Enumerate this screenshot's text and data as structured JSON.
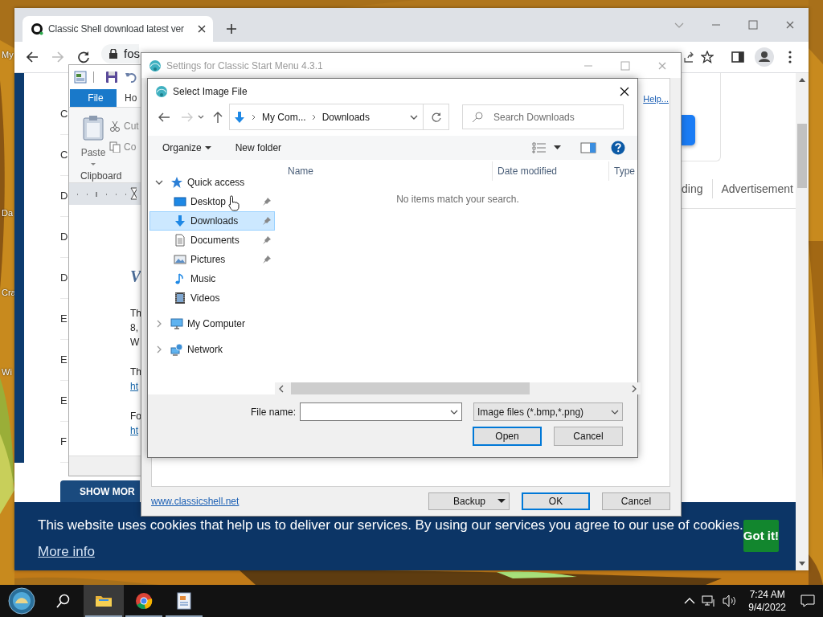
{
  "desktop": {
    "icon_labels": [
      "My",
      "Da",
      "Cra",
      "Wi"
    ]
  },
  "browser": {
    "tab_title": "Classic Shell download latest ver",
    "address": "fos",
    "list_items": [
      "C",
      "C",
      "D",
      "D",
      "D",
      "E",
      "E",
      "E",
      "F"
    ],
    "show_more": "SHOW MOR",
    "ad_tabs": [
      "ding",
      "Advertisement"
    ],
    "cookie_banner": {
      "text": "This website uses cookies that help us to deliver our services. By using our services you agree to our use of cookies.",
      "more_info": "More info",
      "button": "Got it!"
    }
  },
  "wordpad": {
    "tabs": [
      {
        "label": "File",
        "selected": true
      },
      {
        "label": "Ho",
        "selected": false
      }
    ],
    "paste": "Paste",
    "cut": "Cut",
    "copy": "Co",
    "group": "Clipboard",
    "document": [
      {
        "kind": "heading",
        "text": "V"
      },
      {
        "kind": "text",
        "text": "Th"
      },
      {
        "kind": "text",
        "text": "8,"
      },
      {
        "kind": "text",
        "text": "W"
      },
      {
        "kind": "text",
        "text": "Th"
      },
      {
        "kind": "link",
        "text": "ht"
      },
      {
        "kind": "text",
        "text": "Fo"
      },
      {
        "kind": "link",
        "text": "ht"
      }
    ]
  },
  "settings": {
    "title": "Settings for Classic Start Menu 4.3.1",
    "help_link": "Help...",
    "website_link": "www.classicshell.net",
    "buttons": [
      {
        "label": "Backup",
        "kind": "split",
        "default": false
      },
      {
        "label": "OK",
        "kind": "plain",
        "default": true
      },
      {
        "label": "Cancel",
        "kind": "plain",
        "default": false
      }
    ]
  },
  "dialog": {
    "title": "Select Image File",
    "breadcrumb": [
      "My Com...",
      "Downloads"
    ],
    "search": {
      "placeholder": "Search Downloads"
    },
    "commands": [
      "Organize",
      "New folder"
    ],
    "tree": [
      {
        "label": "Quick access",
        "kind": "quick",
        "expanded": true,
        "selected": false,
        "children": [
          {
            "label": "Desktop",
            "kind": "desktop",
            "pinned": true,
            "selected": false
          },
          {
            "label": "Downloads",
            "kind": "downloads",
            "pinned": true,
            "selected": true
          },
          {
            "label": "Documents",
            "kind": "documents",
            "pinned": true,
            "selected": false
          },
          {
            "label": "Pictures",
            "kind": "pictures",
            "pinned": true,
            "selected": false
          },
          {
            "label": "Music",
            "kind": "music",
            "pinned": false,
            "selected": false
          },
          {
            "label": "Videos",
            "kind": "videos",
            "pinned": false,
            "selected": false
          }
        ]
      },
      {
        "label": "My Computer",
        "kind": "computer",
        "expanded": false,
        "selected": false
      },
      {
        "label": "Network",
        "kind": "network",
        "expanded": false,
        "selected": false
      }
    ],
    "columns": [
      "Name",
      "Date modified",
      "Type"
    ],
    "empty_message": "No items match your search.",
    "file_name_label": "File name:",
    "file_type": "Image files (*.bmp,*.png)",
    "buttons": [
      {
        "label": "Open",
        "default": true
      },
      {
        "label": "Cancel",
        "default": false
      }
    ]
  },
  "taskbar": {
    "apps": [
      {
        "kind": "explorer",
        "selected": true
      },
      {
        "kind": "chrome",
        "selected": false
      },
      {
        "kind": "wordpad",
        "selected": false
      }
    ],
    "time": "7:24 AM",
    "date": "9/4/2022"
  }
}
